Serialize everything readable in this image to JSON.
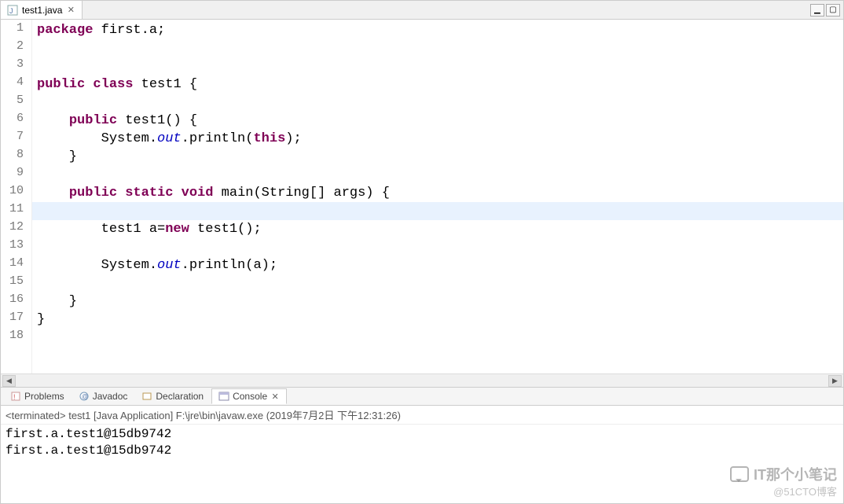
{
  "tab": {
    "name": "test1.java",
    "close_symbol": "✕"
  },
  "window": {
    "minimize": "▁",
    "maximize": "▢"
  },
  "code": {
    "line_numbers": [
      "1",
      "2",
      "3",
      "4",
      "5",
      "6",
      "7",
      "8",
      "9",
      "10",
      "11",
      "12",
      "13",
      "14",
      "15",
      "16",
      "17",
      "18"
    ],
    "fold_lines": [
      6,
      10
    ],
    "highlight_lines": [
      10,
      11,
      12,
      13,
      14,
      15,
      16
    ],
    "current_line": 11,
    "l1_kw1": "package",
    "l1_txt": " first.a;",
    "l4_kw1": "public",
    "l4_kw2": "class",
    "l4_txt": " test1 {",
    "l6_kw1": "public",
    "l6_txt1": " test1() {",
    "l7_txt1": "        System.",
    "l7_fld": "out",
    "l7_txt2": ".println(",
    "l7_kw1": "this",
    "l7_txt3": ");",
    "l8_txt": "    }",
    "l10_kw1": "public",
    "l10_kw2": "static",
    "l10_kw3": "void",
    "l10_txt1": " main(String[] args) {",
    "l12_txt1": "        test1 a=",
    "l12_kw1": "new",
    "l12_txt2": " test1();",
    "l14_txt1": "        System.",
    "l14_fld": "out",
    "l14_txt2": ".println(a);",
    "l16_txt": "    }",
    "l17_txt": "}"
  },
  "bottom_tabs": {
    "problems": "Problems",
    "javadoc": "Javadoc",
    "declaration": "Declaration",
    "console": "Console",
    "close_symbol": "✕"
  },
  "console": {
    "meta_prefix": "<terminated> ",
    "meta_app": "test1 [Java Application] F:\\jre\\bin\\javaw.exe (2019年7月2日 下午12:31:26)",
    "output_line1": "first.a.test1@15db9742",
    "output_line2": "first.a.test1@15db9742"
  },
  "watermark": {
    "text": "IT那个小笔记",
    "sub": "@51CTO博客"
  }
}
